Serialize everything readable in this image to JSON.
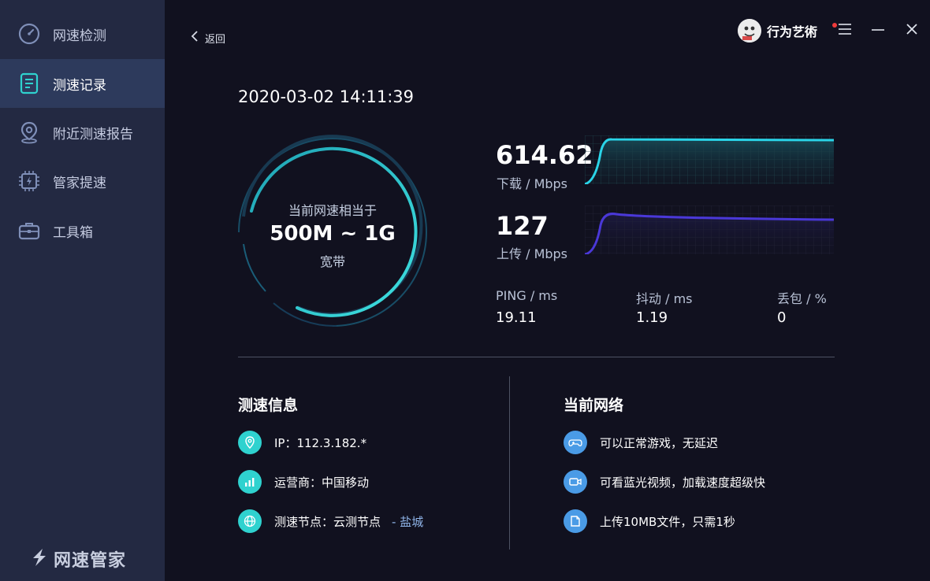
{
  "sidebar": {
    "items": [
      {
        "label": "网速检测",
        "icon": "speedometer-icon",
        "active": false
      },
      {
        "label": "测速记录",
        "icon": "document-icon",
        "active": true
      },
      {
        "label": "附近测速报告",
        "icon": "location-pin-icon",
        "active": false
      },
      {
        "label": "管家提速",
        "icon": "chip-bolt-icon",
        "active": false
      },
      {
        "label": "工具箱",
        "icon": "toolbox-icon",
        "active": false
      }
    ],
    "brand": "网速管家"
  },
  "header": {
    "back_label": "返回",
    "username": "行为艺術",
    "has_notification": true
  },
  "result": {
    "datetime": "2020-03-02 14:11:39",
    "gauge": {
      "line1": "当前网速相当于",
      "line2": "500M ~ 1G",
      "line3": "宽带"
    },
    "download": {
      "value": "614.62",
      "label": "下载 / Mbps",
      "color": "#2ad4e8"
    },
    "upload": {
      "value": "127",
      "label": "上传 / Mbps",
      "color": "#4a38d8"
    },
    "stats": [
      {
        "label": "PING / ms",
        "value": "19.11"
      },
      {
        "label": "抖动 / ms",
        "value": "1.19"
      },
      {
        "label": "丢包 / %",
        "value": "0"
      }
    ]
  },
  "speed_info": {
    "title": "测速信息",
    "rows": [
      {
        "icon": "location-pin-icon",
        "text": "IP：112.3.182.*",
        "sub": ""
      },
      {
        "icon": "signal-bars-icon",
        "text": "运营商：中国移动",
        "sub": ""
      },
      {
        "icon": "globe-icon",
        "text": "测速节点：云测节点",
        "sub": "- 盐城"
      }
    ]
  },
  "network": {
    "title": "当前网络",
    "rows": [
      {
        "icon": "gamepad-icon",
        "text": "可以正常游戏，无延迟"
      },
      {
        "icon": "video-icon",
        "text": "可看蓝光视频，加载速度超级快"
      },
      {
        "icon": "file-icon",
        "text": "上传10MB文件，只需1秒"
      }
    ]
  },
  "colors": {
    "accent_teal": "#2fd2cf",
    "accent_blue": "#4a9be6",
    "sidebar_bg": "#232942",
    "sidebar_active": "#2d3a5c",
    "page_bg": "#11111f"
  }
}
